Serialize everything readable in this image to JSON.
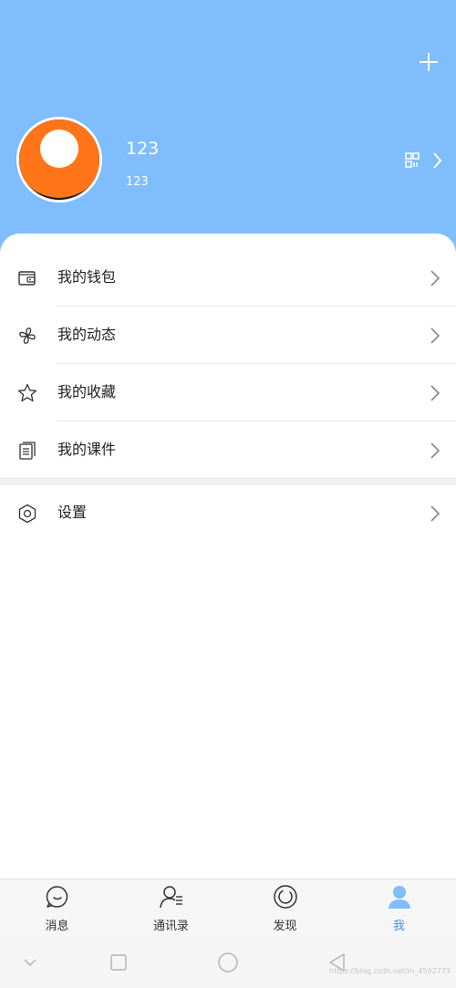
{
  "profile": {
    "name": "123",
    "account": "123"
  },
  "menu": [
    {
      "label": "我的钱包",
      "icon": "wallet-icon"
    },
    {
      "label": "我的动态",
      "icon": "pinwheel-icon"
    },
    {
      "label": "我的收藏",
      "icon": "star-icon"
    },
    {
      "label": "我的课件",
      "icon": "document-icon"
    }
  ],
  "settings": {
    "label": "设置",
    "icon": "hexagon-settings-icon"
  },
  "tabs": [
    {
      "label": "消息",
      "icon": "chat-bubble-icon"
    },
    {
      "label": "通讯录",
      "icon": "contacts-icon"
    },
    {
      "label": "发现",
      "icon": "discover-icon"
    },
    {
      "label": "我",
      "icon": "person-icon",
      "active": true
    }
  ],
  "colors": {
    "header": "#80bdfc",
    "accent": "#4a90e2"
  },
  "watermark": "https://blog.csdn.net/m_4592773"
}
